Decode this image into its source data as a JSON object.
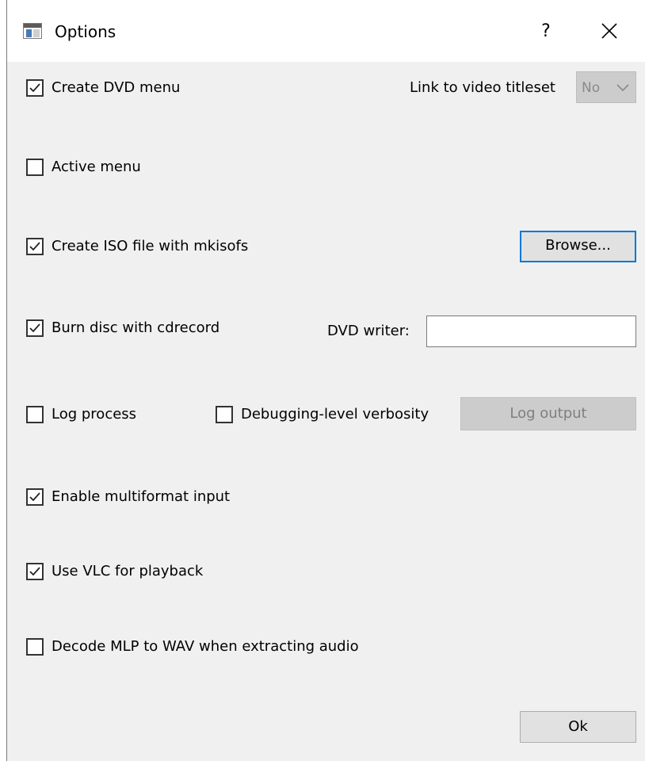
{
  "window": {
    "title": "Options",
    "help_glyph": "?",
    "icons": {
      "app": "app-window-icon",
      "close": "close-icon",
      "check": "checkmark-icon",
      "dropdown": "chevron-down-icon"
    }
  },
  "options": {
    "create_dvd_menu": {
      "label": "Create DVD menu",
      "checked": true
    },
    "active_menu": {
      "label": "Active menu",
      "checked": false
    },
    "create_iso": {
      "label": "Create ISO file with mkisofs",
      "checked": true
    },
    "burn_disc": {
      "label": "Burn disc with cdrecord",
      "checked": true
    },
    "log_process": {
      "label": "Log process",
      "checked": false
    },
    "debug_verbosity": {
      "label": "Debugging-level verbosity",
      "checked": false
    },
    "multiformat": {
      "label": "Enable multiformat input",
      "checked": true
    },
    "vlc_playback": {
      "label": "Use VLC for playback",
      "checked": true
    },
    "decode_mlp": {
      "label": "Decode MLP to WAV when extracting audio",
      "checked": false
    }
  },
  "titleset": {
    "label": "Link to video titleset",
    "value": "No",
    "enabled": false
  },
  "iso": {
    "browse_label": "Browse..."
  },
  "dvd_writer": {
    "label": "DVD writer:",
    "value": ""
  },
  "log": {
    "output_label": "Log output",
    "enabled": false
  },
  "footer": {
    "ok_label": "Ok"
  },
  "colors": {
    "accent": "#0078d7",
    "dialog_bg": "#f0f0f0",
    "disabled_bg": "#cccccc",
    "disabled_text": "#7f7f7f"
  }
}
